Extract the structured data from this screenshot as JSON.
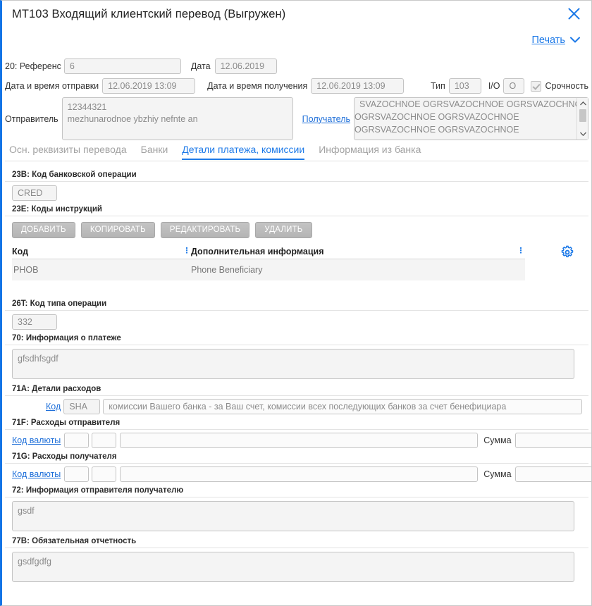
{
  "window": {
    "title": "MT103 Входящий клиентский перевод (Выгружен)",
    "close_icon": "close-icon",
    "accent_color": "#1e7ae8"
  },
  "print": {
    "label": "Печать",
    "chevron_icon": "chevron-down-icon"
  },
  "header_form": {
    "reference_label": "20: Референс",
    "reference_value": "6",
    "date_label": "Дата",
    "date_value": "12.06.2019",
    "send_datetime_label": "Дата и время отправки",
    "send_datetime_value": "12.06.2019 13:09",
    "receive_datetime_label": "Дата и время получения",
    "receive_datetime_value": "12.06.2019 13:09",
    "type_label": "Тип",
    "type_value": "103",
    "io_label": "I/O",
    "io_value": "O",
    "urgency_label": "Срочность",
    "urgency_checked": true,
    "sender_label": "Отправитель",
    "sender_value": "12344321\nmezhunarodnoe ybzhiy nefnte an",
    "receiver_label": "Получатель",
    "receiver_value": "SVAZOCHNOE OGRSVAZOCHNOE OGRSVAZOCHNOE\nOGRSVAZOCHNOE OGRSVAZOCHNOE\nOGRSVAZOCHNOE OGRSVAZOCHNOE"
  },
  "tabs": [
    {
      "label": "Осн. реквизиты перевода",
      "active": false
    },
    {
      "label": "Банки",
      "active": false
    },
    {
      "label": "Детали платежа, комиссии",
      "active": true
    },
    {
      "label": "Информация из банка",
      "active": false
    }
  ],
  "sections": {
    "s23b": {
      "label": "23B: Код банковской операции",
      "value": "CRED"
    },
    "s23e": {
      "label": "23E: Коды инструкций",
      "buttons": [
        {
          "label": "ДОБАВИТЬ",
          "name": "add-button"
        },
        {
          "label": "КОПИРОВАТЬ",
          "name": "copy-button"
        },
        {
          "label": "РЕДАКТИРОВАТЬ",
          "name": "edit-button"
        },
        {
          "label": "УДАЛИТЬ",
          "name": "delete-button"
        }
      ],
      "columns": [
        "Код",
        "Дополнительная информация"
      ],
      "rows": [
        {
          "code": "PHOB",
          "info": "Phone Beneficiary"
        }
      ],
      "settings_icon": "gear-icon"
    },
    "s26t": {
      "label": "26T: Код типа операции",
      "value": "332"
    },
    "s70": {
      "label": "70: Информация о платеже",
      "value": "gfsdhfsgdf"
    },
    "s71a": {
      "label": "71A: Детали расходов",
      "code_link": "Код",
      "code_value": "SHA",
      "description": "комиссии Вашего банка - за Ваш счет, комиссии всех последующих банков за счет бенефициара"
    },
    "s71f": {
      "label": "71F: Расходы отправителя",
      "currency_link": "Код валюты",
      "currency_a": "",
      "currency_b": "",
      "main_value": "",
      "amount_label": "Сумма",
      "amount_value": ""
    },
    "s71g": {
      "label": "71G: Расходы получателя",
      "currency_link": "Код валюты",
      "currency_a": "",
      "currency_b": "",
      "main_value": "",
      "amount_label": "Сумма",
      "amount_value": ""
    },
    "s72": {
      "label": "72: Информация отправителя получателю",
      "value": "gsdf"
    },
    "s77b": {
      "label": "77B: Обязательная отчетность",
      "value": "gsdfgdfg"
    }
  }
}
